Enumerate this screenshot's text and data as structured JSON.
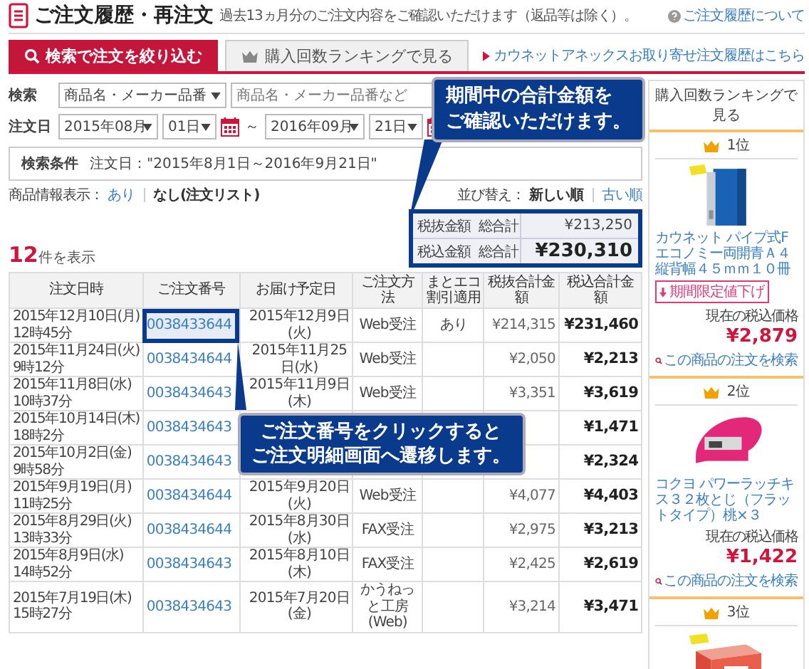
{
  "header": {
    "title": "ご注文履歴・再注文",
    "subtitle": "過去13ヵ月分のご注文内容をご確認いただけます（返品等は除く）。",
    "help_link": "ご注文履歴について"
  },
  "tabs": [
    {
      "label": "検索で注文を絞り込む",
      "selected": true
    },
    {
      "label": "購入回数ランキングで見る",
      "selected": false
    }
  ],
  "annex_link": "カウネットアネックスお取り寄せ注文履歴はこちら",
  "search": {
    "label": "検索",
    "field_select": "商品名・メーカー品番",
    "placeholder": "商品名・メーカー品番など"
  },
  "order_date": {
    "label": "注文日",
    "from_month": "2015年08月",
    "from_day": "01日",
    "separator": "～",
    "to_month": "2016年09月",
    "to_day": "21日"
  },
  "conditions": {
    "label": "検索条件",
    "value": "注文日：\"2015年8月1日～2016年9月21日\""
  },
  "display": {
    "label": "商品情報表示：",
    "options": [
      {
        "label": "あり",
        "selected": false
      },
      {
        "label": "なし(注文リスト)",
        "selected": true
      }
    ]
  },
  "sort": {
    "label": "並び替え：",
    "options": [
      {
        "label": "新しい順",
        "selected": true
      },
      {
        "label": "古い順",
        "selected": false
      }
    ]
  },
  "result_count": "**12**件を表示",
  "totals": {
    "highlighted": true,
    "rows": [
      {
        "label": "税抜金額",
        "sublabel": "総合計",
        "value": "¥213,250",
        "emphasis": false
      },
      {
        "label": "税込金額",
        "sublabel": "総合計",
        "value": "¥230,310",
        "emphasis": true
      }
    ]
  },
  "table": {
    "columns": [
      "注文日時",
      "ご注文番号",
      "お届け予定日",
      "ご注文方法",
      "まとエコ割引適用",
      "税抜合計金額",
      "税込合計金額"
    ],
    "rows": [
      {
        "date": "2015年12月10日(月)",
        "time": "12時45分",
        "order_no": "0038433644",
        "highlighted": true,
        "delivery": "2015年12月9日(火)",
        "method": "Web受注",
        "eco": "あり",
        "subtotal": "¥214,315",
        "total": "¥231,460"
      },
      {
        "date": "2015年11月24日(火)",
        "time": "9時12分",
        "order_no": "0038434644",
        "highlighted": false,
        "delivery": "2015年11月25日(水)",
        "method": "Web受注",
        "subtotal": "¥2,050",
        "total": "¥2,213"
      },
      {
        "date": "2015年11月8日(水)",
        "time": "10時37分",
        "order_no": "0038434643",
        "highlighted": false,
        "delivery": "2015年11月9日(木)",
        "method": "Web受注",
        "subtotal": "¥3,351",
        "total": "¥3,619"
      },
      {
        "date": "2015年10月14日(木)",
        "time": "18時2分",
        "order_no": "0038434643",
        "highlighted": false,
        "total": "¥1,471"
      },
      {
        "date": "2015年10月2日(金)",
        "time": "9時58分",
        "order_no": "0038434643",
        "highlighted": false,
        "total": "¥2,324"
      },
      {
        "date": "2015年9月19日(月)",
        "time": "11時25分",
        "order_no": "0038434644",
        "highlighted": false,
        "delivery": "2015年9月20日(火)",
        "method": "Web受注",
        "subtotal": "¥4,077",
        "total": "¥4,403"
      },
      {
        "date": "2015年8月29日(火)",
        "time": "13時33分",
        "order_no": "0038434644",
        "highlighted": false,
        "delivery": "2015年8月30日(水)",
        "method": "FAX受注",
        "subtotal": "¥2,975",
        "total": "¥3,213"
      },
      {
        "date": "2015年8月9日(水)",
        "time": "14時52分",
        "order_no": "0038434643",
        "highlighted": false,
        "delivery": "2015年8月10日(木)",
        "method": "FAX受注",
        "subtotal": "¥2,425",
        "total": "¥2,619"
      },
      {
        "date": "2015年7月19日(木)",
        "time": "15時27分",
        "order_no": "0038434643",
        "highlighted": false,
        "delivery": "2015年7月20日(金)",
        "method": "かうねっと工房(Web)",
        "subtotal": "¥3,214",
        "total": "¥3,471"
      }
    ]
  },
  "ranking": {
    "header": "購入回数ランキングで見る",
    "items": [
      {
        "rank": "1位",
        "name": "カウネット パイプ式Fエコノミー両開青Ａ４縦背幅４５ｍｍ１０冊",
        "badge": "期間限定値下げ",
        "price_label": "現在の税込価格",
        "price": "¥2,879",
        "search_link": "この商品の注文を検索"
      },
      {
        "rank": "2位",
        "name": "コクヨ パワーラッチキス３２枚とじ（フラットタイプ）桃×３",
        "price_label": "現在の税込価格",
        "price": "¥1,422",
        "search_link": "この商品の注文を検索"
      },
      {
        "rank": "3位"
      }
    ]
  },
  "callouts": [
    {
      "lines": [
        "期間中の合計金額を",
        "ご確認いただけます。"
      ]
    },
    {
      "lines": [
        "ご注文番号をクリックすると",
        "ご注文明細画面へ遷移します。"
      ]
    }
  ]
}
